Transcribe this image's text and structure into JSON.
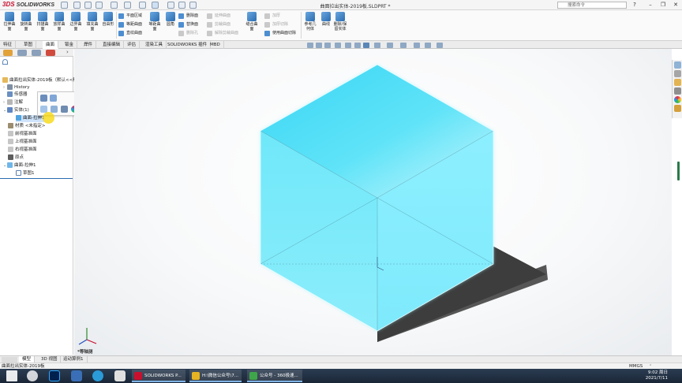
{
  "app": {
    "logo": "3DS SOLIDWORKS",
    "doc_title": "曲面拉出实体-2019板.SLDPRT *",
    "search_placeholder": "搜索命令"
  },
  "cmd": {
    "tools": [
      "拉伸曲面",
      "旋转曲面",
      "扫描曲面",
      "放样曲面",
      "边界曲面",
      "填充曲面",
      "自由形",
      "等距曲面",
      "圆角",
      "缝合曲面",
      "参考几何体",
      "曲线",
      "删除/保留实体"
    ],
    "rows": [
      {
        "label": "平面区域",
        "disabled": false
      },
      {
        "label": "等距曲面",
        "disabled": false
      },
      {
        "label": "直纹曲面",
        "disabled": false
      },
      {
        "label": "删除面",
        "disabled": false
      },
      {
        "label": "替换面",
        "disabled": false
      },
      {
        "label": "删除孔",
        "disabled": true
      },
      {
        "label": "延伸曲面",
        "disabled": true
      },
      {
        "label": "剪裁曲面",
        "disabled": true
      },
      {
        "label": "解除剪裁曲面",
        "disabled": true
      },
      {
        "label": "加厚",
        "disabled": true
      },
      {
        "label": "加厚切除",
        "disabled": true
      },
      {
        "label": "使用曲面切除",
        "disabled": false
      }
    ]
  },
  "tabs": [
    "特征",
    "草图",
    "曲面",
    "钣金",
    "焊件",
    "直接编辑",
    "评估",
    "渲染工具",
    "SOLIDWORKS 插件",
    "MBD"
  ],
  "active_tab": 2,
  "tree": {
    "root": "曲面拉出实体-2019板（默认<<默",
    "items": [
      "History",
      "传感器",
      "注解",
      "实体(1)",
      "曲面-拉伸1",
      "材质 <未指定>",
      "前视基准面",
      "上视基准面",
      "右视基准面",
      "原点",
      "曲面-拉伸1",
      "草图1"
    ]
  },
  "view_label": "*等轴测",
  "bottom_tabs": [
    "模型",
    "3D 视图",
    "运动算例1"
  ],
  "status": {
    "left": "曲面拉出实体-2019板",
    "units": "MMGS"
  },
  "taskbar": {
    "windows": [
      {
        "label": "SOLIDWORKS P...",
        "color": "#c8102e"
      },
      {
        "label": "H:\\微信公众号\\7...",
        "color": "#e6b422"
      },
      {
        "label": "公众号 - 360极速...",
        "color": "#3fa54a"
      }
    ],
    "time": "9:02 周日",
    "date": "2021/7/11"
  },
  "colors": {
    "solid_face": "#64e6f8",
    "solid_top": "#3fd8f5",
    "shadow": "#3a3a3a",
    "accent": "#2b6cb0"
  }
}
